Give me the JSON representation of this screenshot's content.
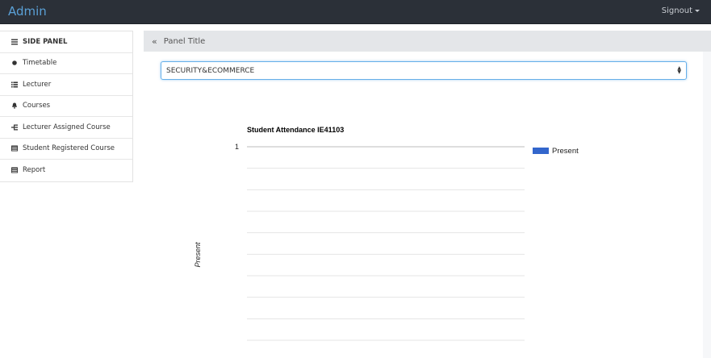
{
  "navbar": {
    "brand": "Admin",
    "signout": "Signout"
  },
  "sidebar": {
    "header": "SIDE PANEL",
    "items": [
      {
        "label": "Timetable",
        "icon": "dot-icon"
      },
      {
        "label": "Lecturer",
        "icon": "list-icon"
      },
      {
        "label": "Courses",
        "icon": "bell-icon"
      },
      {
        "label": "Lecturer Assigned Course",
        "icon": "tree-icon"
      },
      {
        "label": "Student Registered Course",
        "icon": "table-icon"
      },
      {
        "label": "Report",
        "icon": "table-icon"
      }
    ]
  },
  "panel": {
    "title": "Panel Title"
  },
  "course_select": {
    "value": "SECURITY&ECOMMERCE"
  },
  "chart_data": {
    "type": "bar",
    "title": "Student Attendance IE41103",
    "ylabel": "Present",
    "xlabel": "",
    "y_ticks": [
      "1"
    ],
    "ylim": [
      0,
      1
    ],
    "grid": true,
    "legend_position": "right",
    "series": [
      {
        "name": "Present",
        "color": "#3366cc",
        "values": []
      }
    ],
    "categories": []
  }
}
